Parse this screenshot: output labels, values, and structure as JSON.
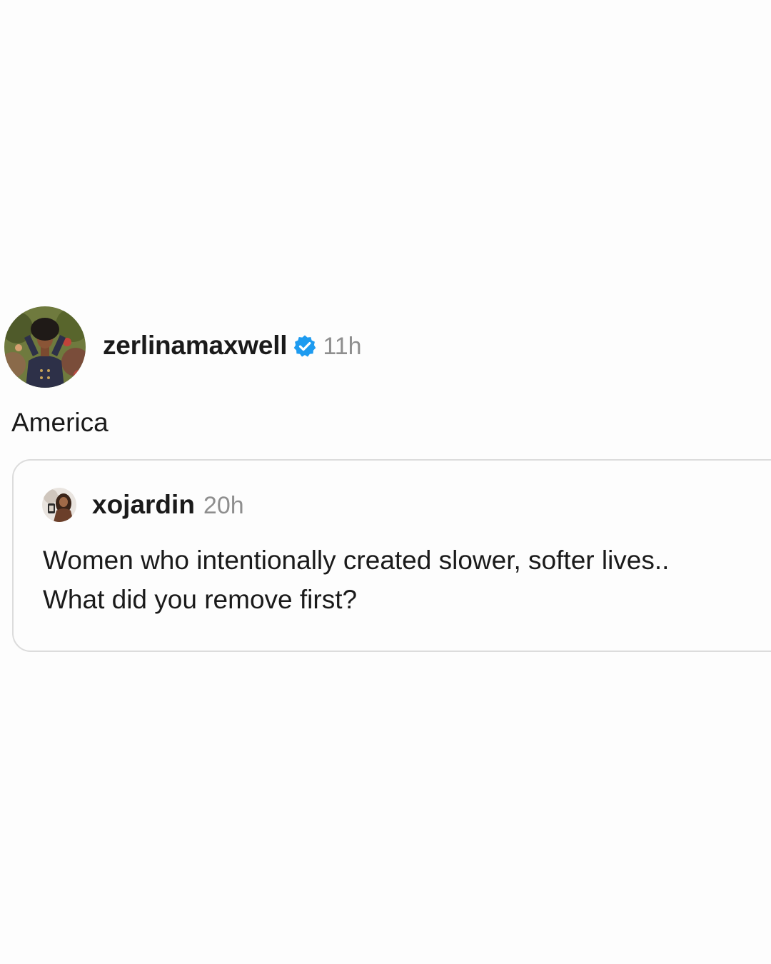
{
  "post": {
    "author": {
      "username": "zerlinamaxwell",
      "verified_icon": "verified-badge-icon",
      "time": "11h"
    },
    "text": "America",
    "quoted_post": {
      "author": {
        "username": "xojardin",
        "time": "20h"
      },
      "text_lines": [
        "Women who intentionally created slower, softer lives..",
        "What did you remove first?"
      ]
    }
  },
  "colors": {
    "background": "#fdfdfd",
    "text": "#1a1a1a",
    "muted": "#8e8e8e",
    "verified": "#1d9bf0",
    "card_border": "#dcdcdc"
  }
}
